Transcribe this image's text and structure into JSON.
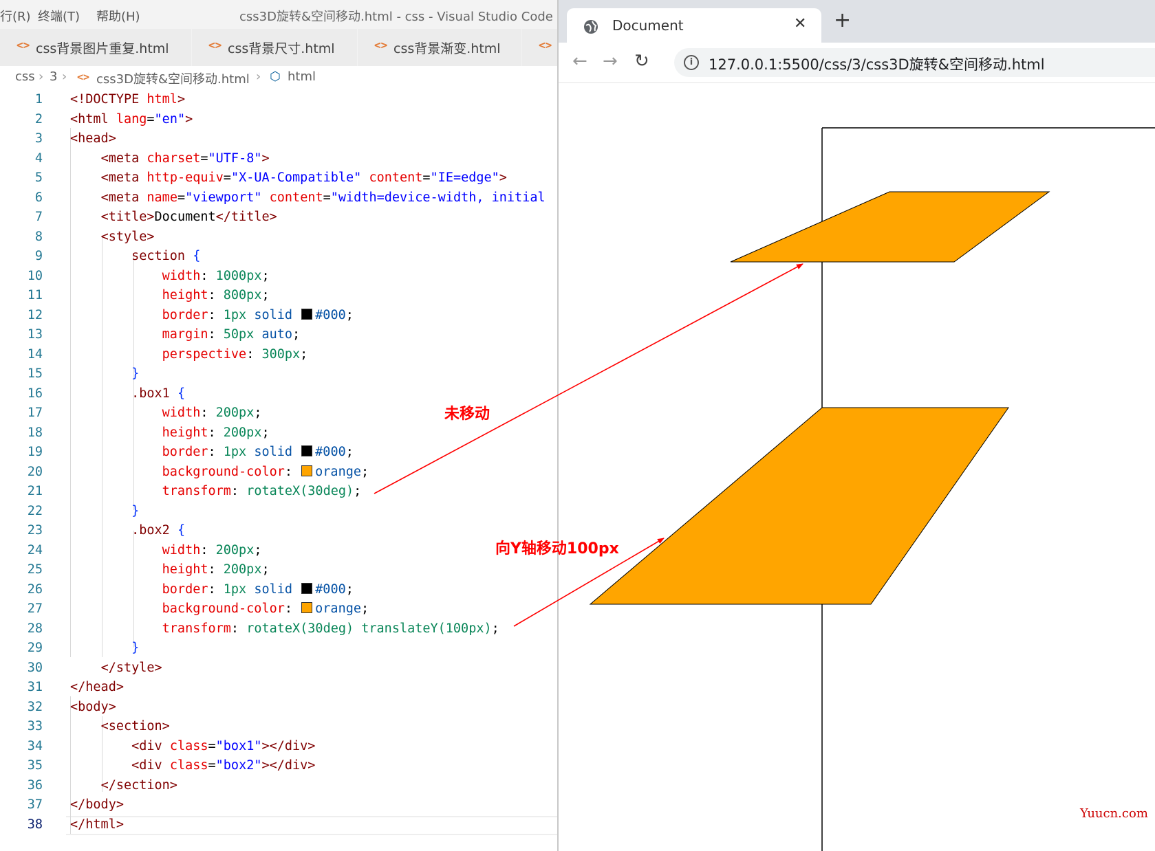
{
  "vscode": {
    "menu": [
      "行(R)",
      "终端(T)",
      "帮助(H)"
    ],
    "window_title": "css3D旋转&空间移动.html - css - Visual Studio Code",
    "tabs": [
      {
        "label": "css背景图片重复.html"
      },
      {
        "label": "css背景尺寸.html"
      },
      {
        "label": "css背景渐变.html"
      },
      {
        "label": ""
      }
    ],
    "breadcrumb": {
      "folder1": "css",
      "folder2": "3",
      "file": "css3D旋转&空间移动.html",
      "symbol": "html"
    },
    "current_line": 38
  },
  "browser": {
    "tab_title": "Document",
    "url": "127.0.0.1:5500/css/3/css3D旋转&空间移动.html"
  },
  "annotations": {
    "not_moved": "未移动",
    "moved_y": "向Y轴移动100px"
  },
  "watermark": "Yuucn.com",
  "colors": {
    "box_fill": "#ffa500",
    "arrow": "#ff0000",
    "black_swatch": "#000000"
  },
  "icons": [
    "file-html-icon",
    "chevron-right-icon",
    "symbol-icon",
    "globe-icon",
    "close-icon",
    "plus-icon",
    "back-icon",
    "forward-icon",
    "reload-icon",
    "info-icon"
  ]
}
